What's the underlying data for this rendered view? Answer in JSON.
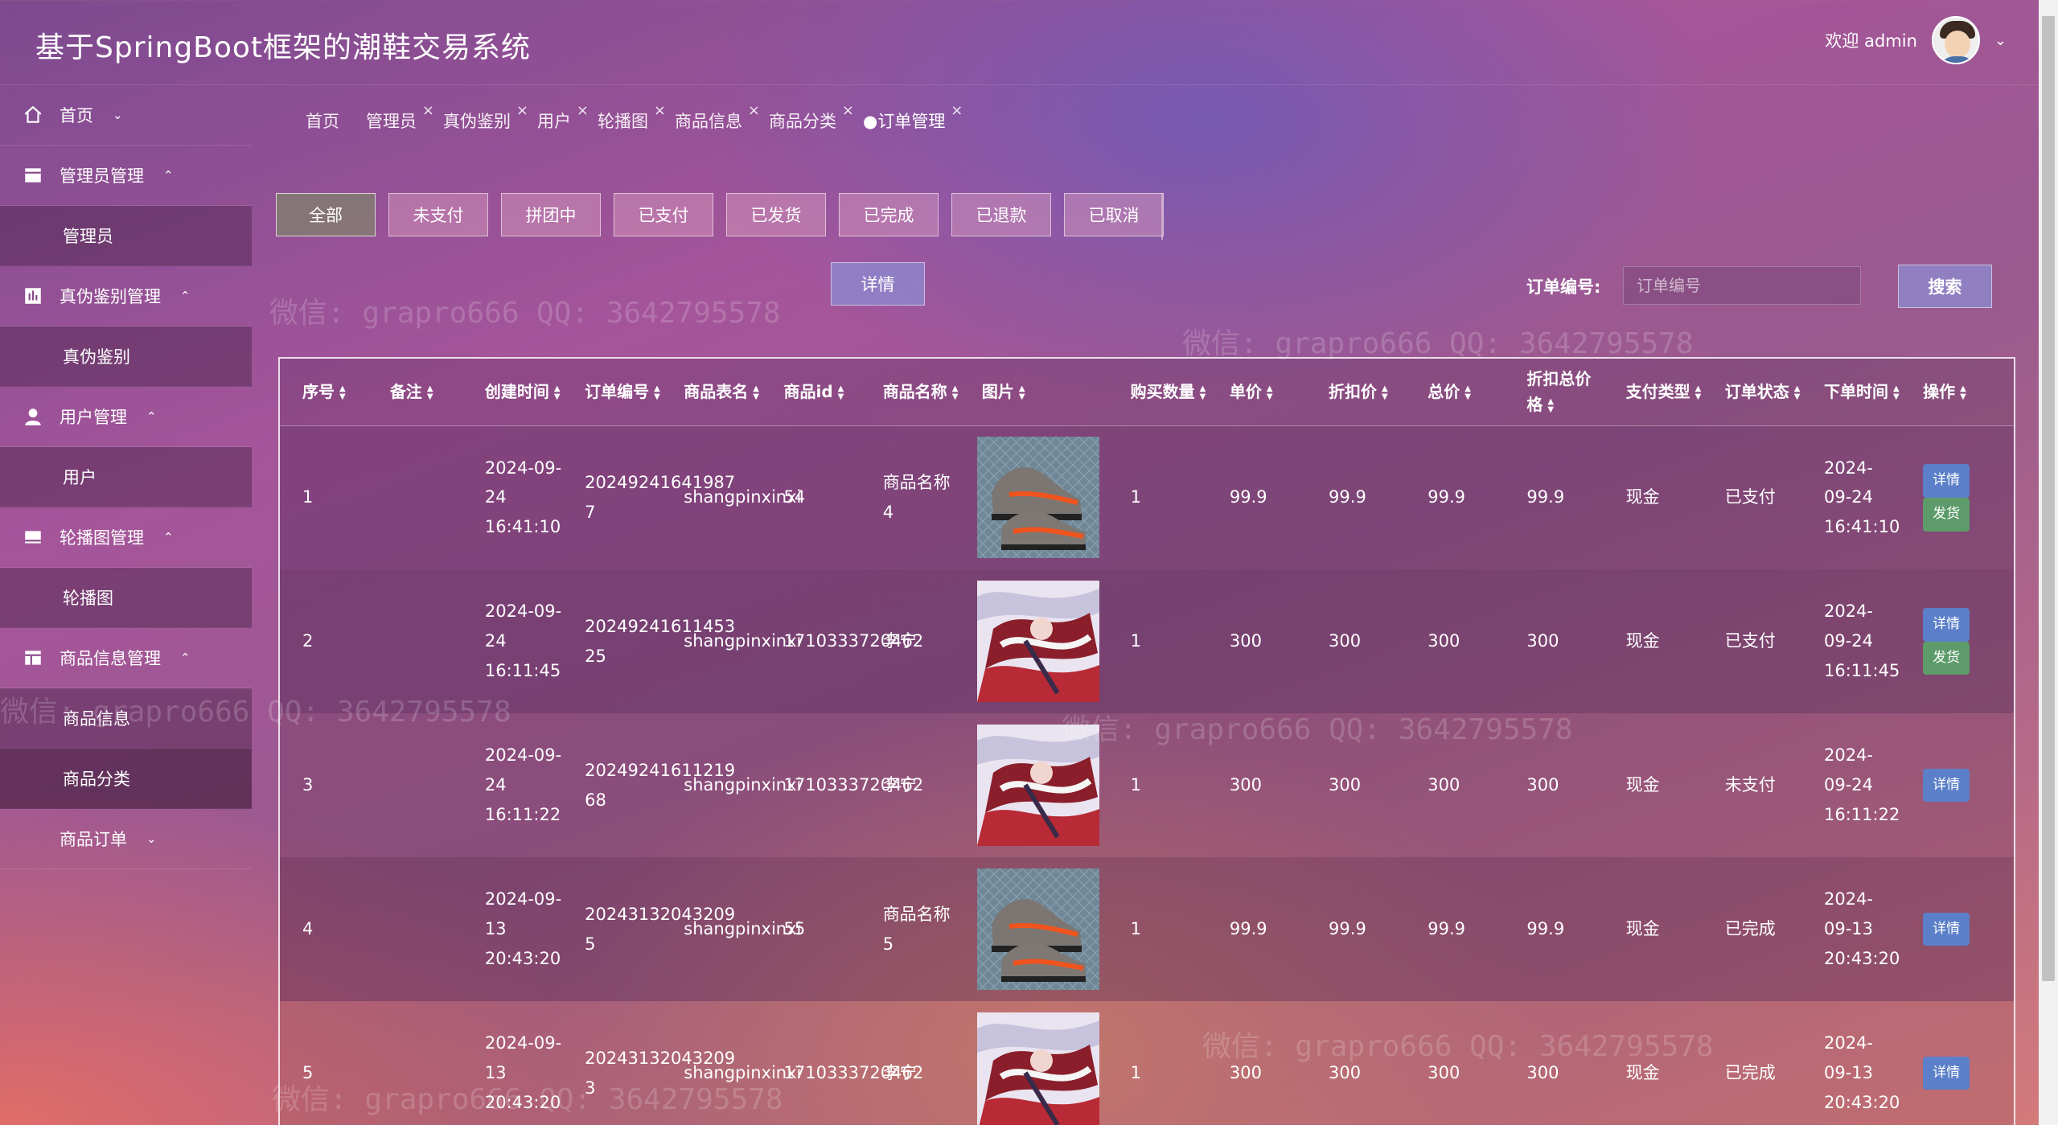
{
  "app": {
    "title": "基于SpringBoot框架的潮鞋交易系统",
    "welcome": "欢迎 admin"
  },
  "sidebar": {
    "items": [
      {
        "label": "首页",
        "type": "group",
        "caret": "⌄",
        "icon": "home-icon"
      },
      {
        "label": "管理员管理",
        "type": "group",
        "caret": "⌃",
        "icon": "admin-icon"
      },
      {
        "label": "管理员",
        "type": "sub"
      },
      {
        "label": "真伪鉴别管理",
        "type": "group",
        "caret": "⌃",
        "icon": "chart-icon"
      },
      {
        "label": "真伪鉴别",
        "type": "sub"
      },
      {
        "label": "用户管理",
        "type": "group",
        "caret": "⌃",
        "icon": "user-icon"
      },
      {
        "label": "用户",
        "type": "sub"
      },
      {
        "label": "轮播图管理",
        "type": "group",
        "caret": "⌃",
        "icon": "carousel-icon"
      },
      {
        "label": "轮播图",
        "type": "sub"
      },
      {
        "label": "商品信息管理",
        "type": "group",
        "caret": "⌃",
        "icon": "goods-icon"
      },
      {
        "label": "商品信息",
        "type": "sub"
      },
      {
        "label": "商品分类",
        "type": "sub",
        "active": true
      },
      {
        "label": "商品订单",
        "type": "group",
        "caret": "⌄",
        "icon": ""
      }
    ]
  },
  "tabs": [
    {
      "label": "首页",
      "closable": false
    },
    {
      "label": "管理员",
      "closable": true
    },
    {
      "label": "真伪鉴别",
      "closable": true
    },
    {
      "label": "用户",
      "closable": true
    },
    {
      "label": "轮播图",
      "closable": true
    },
    {
      "label": "商品信息",
      "closable": true
    },
    {
      "label": "商品分类",
      "closable": true
    },
    {
      "label": "●订单管理",
      "closable": true,
      "active": true
    }
  ],
  "status_filters": [
    "全部",
    "未支付",
    "拼团中",
    "已支付",
    "已发货",
    "已完成",
    "已退款",
    "已取消"
  ],
  "toolbar": {
    "detail_label": "详情",
    "search_label": "订单编号:",
    "search_placeholder": "订单编号",
    "search_button": "搜索"
  },
  "table": {
    "columns": [
      "序号",
      "备注",
      "创建时间",
      "订单编号",
      "商品表名",
      "商品id",
      "商品名称",
      "图片",
      "购买数量",
      "单价",
      "折扣价",
      "总价",
      "折扣总价格",
      "支付类型",
      "订单状态",
      "下单时间",
      "操作"
    ],
    "rows": [
      {
        "no": "1",
        "remark": "",
        "created": "2024-09-24 16:41:10",
        "order_no": "20249241641987 7",
        "table_name": "shangpinxinxi",
        "goods_id": "54",
        "goods_name": "商品名称4",
        "image": "sneaker",
        "qty": "1",
        "price": "99.9",
        "discount_price": "99.9",
        "total": "99.9",
        "discount_total": "99.9",
        "pay_type": "现金",
        "status": "已支付",
        "order_time": "2024-09-24 16:41:10",
        "actions": [
          "详情",
          "发货"
        ]
      },
      {
        "no": "2",
        "remark": "",
        "created": "2024-09-24 16:11:45",
        "order_no": "20249241611453 25",
        "table_name": "shangpinxinxi",
        "goods_id": "1710333720462",
        "goods_name": "李宁",
        "image": "art",
        "qty": "1",
        "price": "300",
        "discount_price": "300",
        "total": "300",
        "discount_total": "300",
        "pay_type": "现金",
        "status": "已支付",
        "order_time": "2024-09-24 16:11:45",
        "actions": [
          "详情",
          "发货"
        ]
      },
      {
        "no": "3",
        "remark": "",
        "created": "2024-09-24 16:11:22",
        "order_no": "20249241611219 68",
        "table_name": "shangpinxinxi",
        "goods_id": "1710333720462",
        "goods_name": "李宁",
        "image": "art",
        "qty": "1",
        "price": "300",
        "discount_price": "300",
        "total": "300",
        "discount_total": "300",
        "pay_type": "现金",
        "status": "未支付",
        "order_time": "2024-09-24 16:11:22",
        "actions": [
          "详情"
        ]
      },
      {
        "no": "4",
        "remark": "",
        "created": "2024-09-13 20:43:20",
        "order_no": "20243132043209 5",
        "table_name": "shangpinxinxi",
        "goods_id": "55",
        "goods_name": "商品名称5",
        "image": "sneaker",
        "qty": "1",
        "price": "99.9",
        "discount_price": "99.9",
        "total": "99.9",
        "discount_total": "99.9",
        "pay_type": "现金",
        "status": "已完成",
        "order_time": "2024-09-13 20:43:20",
        "actions": [
          "详情"
        ]
      },
      {
        "no": "5",
        "remark": "",
        "created": "2024-09-13 20:43:20",
        "order_no": "20243132043209 3",
        "table_name": "shangpinxinxi",
        "goods_id": "1710333720462",
        "goods_name": "李宁",
        "image": "art",
        "qty": "1",
        "price": "300",
        "discount_price": "300",
        "total": "300",
        "discount_total": "300",
        "pay_type": "现金",
        "status": "已完成",
        "order_time": "2024-09-13 20:43:20",
        "actions": [
          "详情"
        ]
      }
    ]
  },
  "watermark": "微信: grapro666 QQ: 3642795578",
  "colors": {
    "detail_btn": "#5b7fc8",
    "ship_btn": "#5d9c6a"
  }
}
